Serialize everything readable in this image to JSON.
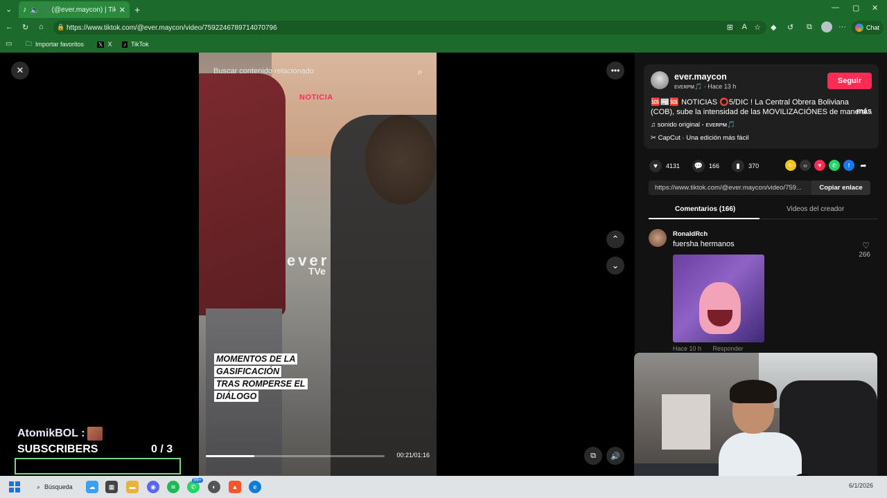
{
  "browser": {
    "tab_title": "🎵(@ever.maycon) | TikTok",
    "url": "https://www.tiktok.com/@ever.maycon/video/7592246789714070796",
    "chat_label": "Chat",
    "bookmarks": [
      {
        "label": "Importar favoritos"
      },
      {
        "label": "X"
      },
      {
        "label": "TikTok"
      }
    ]
  },
  "video": {
    "search_placeholder": "Buscar contenido relacionado",
    "noticia_label": "NOTICIA",
    "watermark_top": "ever",
    "watermark_bottom": "TVe",
    "caption_lines": [
      "MOMENTOS DE LA",
      "GASIFICACIÓN",
      "TRAS ROMPERSE EL",
      "DIÁLOGO"
    ],
    "time": "00:21/01:16",
    "progress": 0.27
  },
  "post": {
    "username": "ever.maycon",
    "subline": "ᴇᴠᴇʀᴘᴍ🎵 · Hace 13 h",
    "follow_label": "Seguir",
    "description": "🆘📰🆘 NOTICIAS ⭕5/DIC ! La Central Obrera Boliviana (COB), sube la intensidad de las MOVILIZACIÓNES de manera...",
    "more_label": "más",
    "sound": "sonido original - ᴇᴠᴇʀᴘᴍ🎵",
    "capcut": "CapCut · Una edición más fácil",
    "likes": "4131",
    "comments": "166",
    "saves": "370",
    "link": "https://www.tiktok.com/@ever.maycon/video/759...",
    "copy_label": "Copiar enlace",
    "tab_comments": "Comentarios (166)",
    "tab_creator": "Videos del creador"
  },
  "comment": {
    "user": "RonaldRch",
    "text": "fuersha hermanos",
    "likes": "266",
    "time": "Hace 10 h",
    "reply_label": "Responder"
  },
  "overlay": {
    "name": "AtomikBOL :",
    "subs_label": "SUBSCRIBERS",
    "subs_count": "0  / 3"
  },
  "taskbar": {
    "search_label": "Búsqueda",
    "badge": "99+",
    "date": "6/1/2026"
  },
  "colors": {
    "browser_green": "#1d6b2c",
    "tiktok_red": "#fe2c55",
    "panel_bg": "#121212"
  }
}
